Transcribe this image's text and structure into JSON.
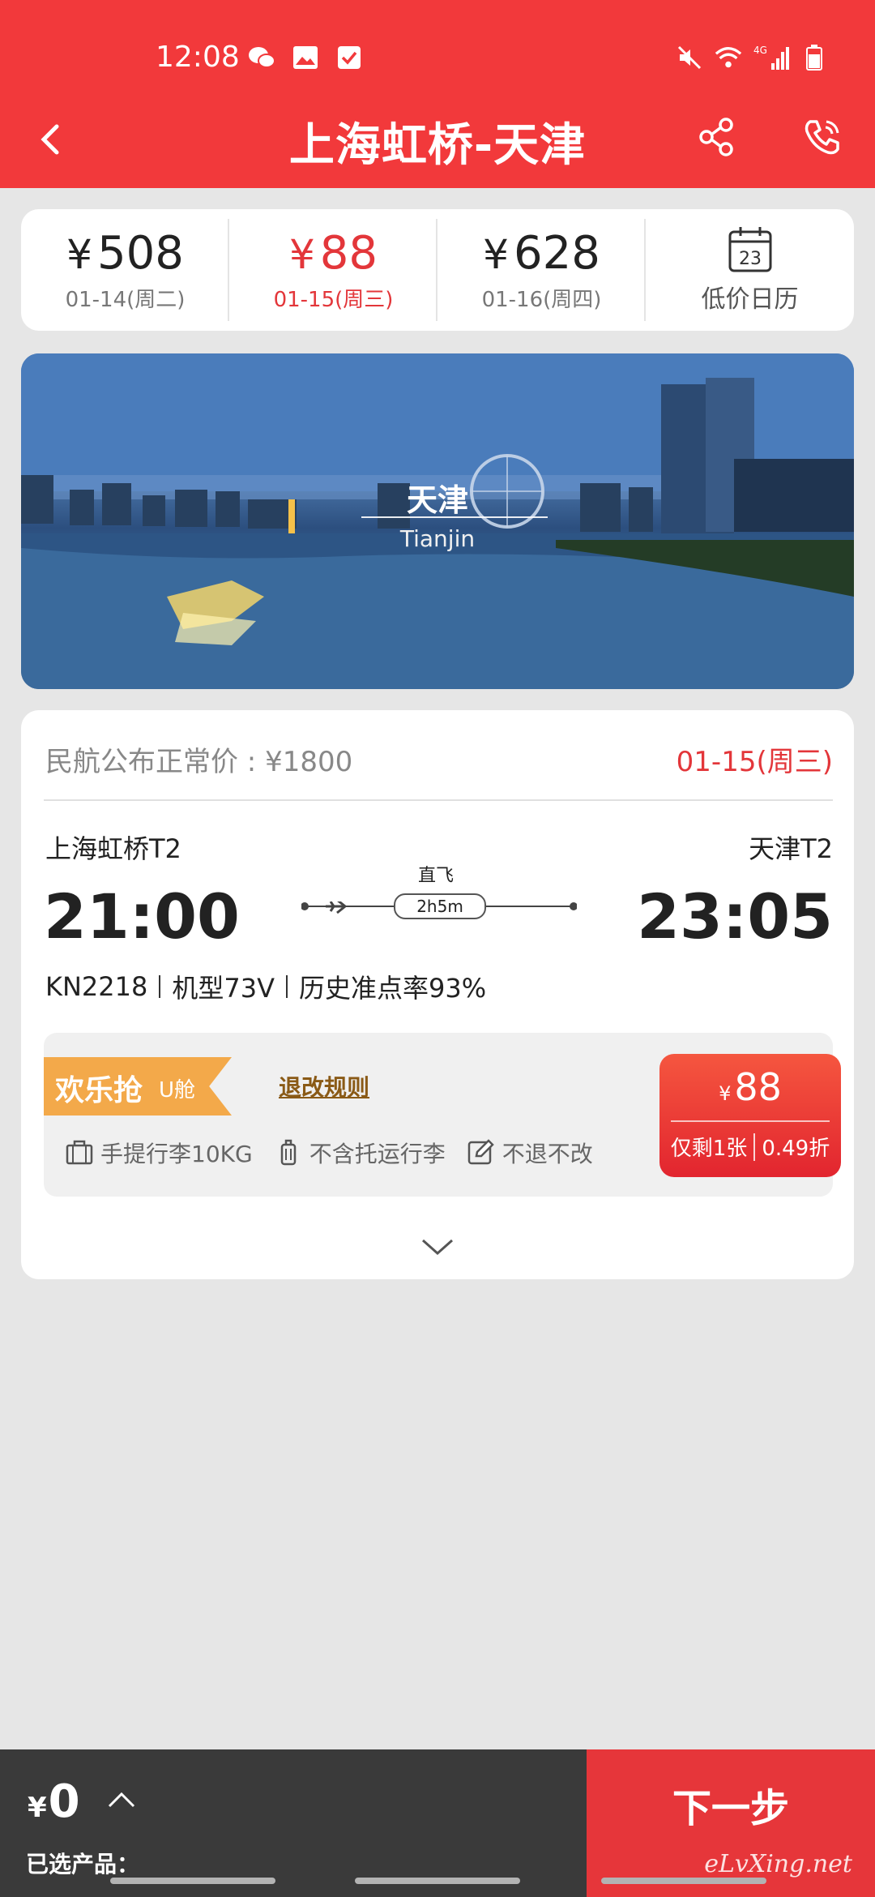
{
  "status_bar": {
    "time": "12:08",
    "left_icons": [
      "wechat-icon",
      "gallery-icon",
      "checkbox-icon"
    ],
    "right_icons": [
      "mute-icon",
      "wifi-icon",
      "signal-4g-icon",
      "battery-icon"
    ],
    "network": "4G"
  },
  "header": {
    "title": "上海虹桥-天津",
    "bg_color": "#f2393b",
    "actions": [
      "back-icon",
      "share-icon",
      "phone-icon"
    ]
  },
  "date_strip": {
    "dates": [
      {
        "price": "508",
        "currency": "¥",
        "label": "01-14(周二)",
        "active": false
      },
      {
        "price": "88",
        "currency": "¥",
        "label": "01-15(周三)",
        "active": true
      },
      {
        "price": "628",
        "currency": "¥",
        "label": "01-16(周四)",
        "active": false
      }
    ],
    "calendar": {
      "day": "23",
      "label": "低价日历"
    }
  },
  "banner": {
    "city": "天津",
    "city_en": "Tianjin"
  },
  "flight": {
    "reference_price": "民航公布正常价 : ¥1800",
    "date": "01-15(周三)",
    "departure_airport": "上海虹桥T2",
    "arrival_airport": "天津T2",
    "departure_time": "21:00",
    "arrival_time": "23:05",
    "type": "直飞",
    "duration": "2h5m",
    "flight_no": "KN2218",
    "aircraft": "机型73V",
    "on_time_rate": "历史准点率93%"
  },
  "fare": {
    "tag_name": "欢乐抢",
    "cabin": "U舱",
    "rule_link": "退改规则",
    "features": [
      {
        "icon": "luggage-icon",
        "text": "手提行李10KG"
      },
      {
        "icon": "suitcase-icon",
        "text": "不含托运行李"
      },
      {
        "icon": "edit-icon",
        "text": "不退不改"
      }
    ],
    "price_currency": "¥",
    "price": "88",
    "remaining": "仅剩1张",
    "discount": "0.49折"
  },
  "bottom_bar": {
    "currency": "¥",
    "total": "0",
    "selected_label": "已选产品：",
    "next_button": "下一步",
    "watermark": "eLvXing.net"
  },
  "colors": {
    "accent_red": "#e3363a",
    "fare_tag_orange": "#f3a94a",
    "bottom_dark": "#3a3a3a"
  }
}
